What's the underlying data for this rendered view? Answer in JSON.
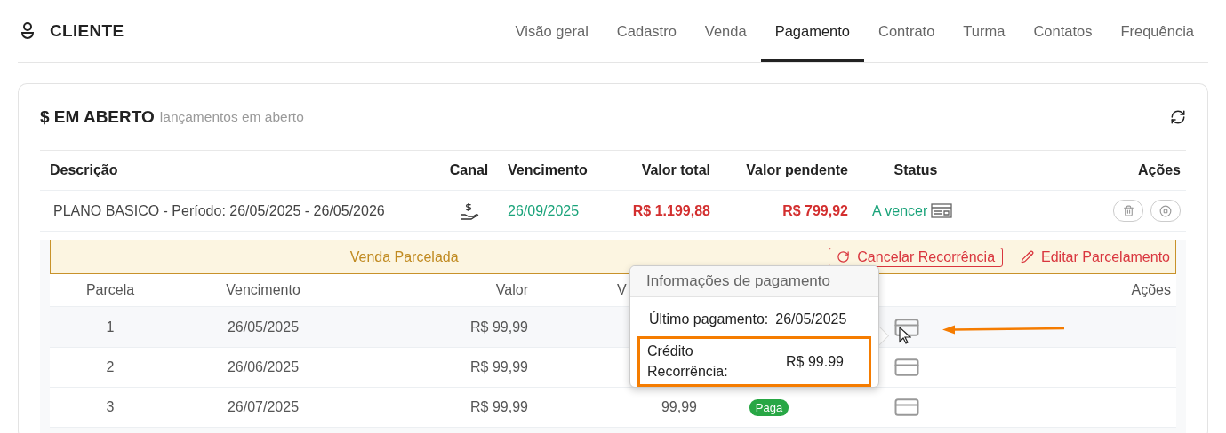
{
  "header": {
    "title": "CLIENTE"
  },
  "tabs": [
    {
      "label": "Visão geral",
      "selected": false
    },
    {
      "label": "Cadastro",
      "selected": false
    },
    {
      "label": "Venda",
      "selected": false
    },
    {
      "label": "Pagamento",
      "selected": true
    },
    {
      "label": "Contrato",
      "selected": false
    },
    {
      "label": "Turma",
      "selected": false
    },
    {
      "label": "Contatos",
      "selected": false
    },
    {
      "label": "Frequência",
      "selected": false
    }
  ],
  "panel": {
    "title": "$ EM ABERTO",
    "subtitle": "lançamentos em aberto"
  },
  "table": {
    "columns": [
      "Descrição",
      "Canal",
      "Vencimento",
      "Valor total",
      "Valor pendente",
      "Status",
      "Ações"
    ],
    "rows": [
      {
        "description": "PLANO BASICO - Período: 26/05/2025 - 26/05/2026",
        "due": "26/09/2025",
        "total": "R$ 1.199,88",
        "pending": "R$ 799,92",
        "status": "A vencer"
      }
    ]
  },
  "installments": {
    "title": "Venda Parcelada",
    "actions": [
      {
        "kind": "outlined",
        "label": "Cancelar Recorrência"
      },
      {
        "kind": "link",
        "label": "Editar Parcelamento"
      }
    ],
    "columns": [
      "Parcela",
      "Vencimento",
      "Valor",
      "V",
      "Ações"
    ],
    "rows": [
      {
        "number": "1",
        "due": "26/05/2025",
        "value": "R$ 99,99"
      },
      {
        "number": "2",
        "due": "26/06/2025",
        "value": "R$ 99,99"
      },
      {
        "number": "3",
        "due": "26/07/2025",
        "value": "R$ 99,99",
        "column_4": "99,99",
        "status": "Paga"
      }
    ]
  },
  "popover": {
    "title": "Informações de pagamento",
    "rows": [
      {
        "label": "Último pagamento:",
        "value": "26/05/2025",
        "highlighted": false
      },
      {
        "label": "Crédito Recorrência:",
        "value": "R$ 99.99",
        "highlighted": true
      }
    ]
  }
}
